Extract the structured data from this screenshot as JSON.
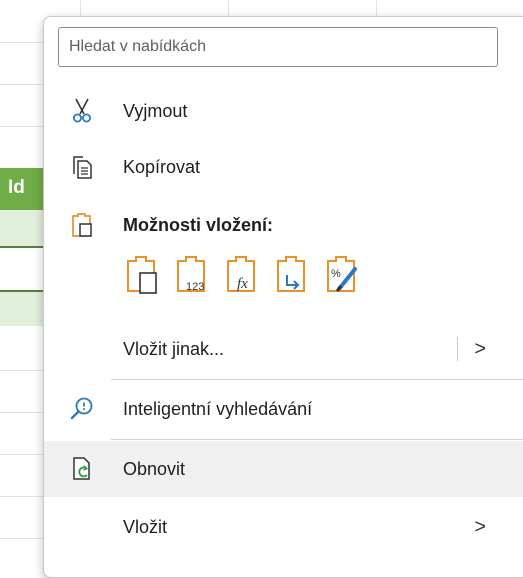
{
  "search": {
    "placeholder": "Hledat v nabídkách"
  },
  "sheet": {
    "header_cell": "Id"
  },
  "menu": {
    "cut": "Vyjmout",
    "copy": "Kopírovat",
    "paste_options": "Možnosti vložení:",
    "paste_icons": [
      "paste-icon",
      "paste-values-icon",
      "paste-formulas-icon",
      "paste-transpose-icon",
      "paste-formatting-icon"
    ],
    "paste_special": "Vložit jinak...",
    "smart_lookup": "Inteligentní vyhledávání",
    "refresh": "Obnovit",
    "insert": "Vložit"
  },
  "colors": {
    "accent_orange": "#e8912d",
    "accent_blue": "#2b79c2",
    "accent_green": "#2e9a47",
    "table_green": "#70ad47"
  }
}
